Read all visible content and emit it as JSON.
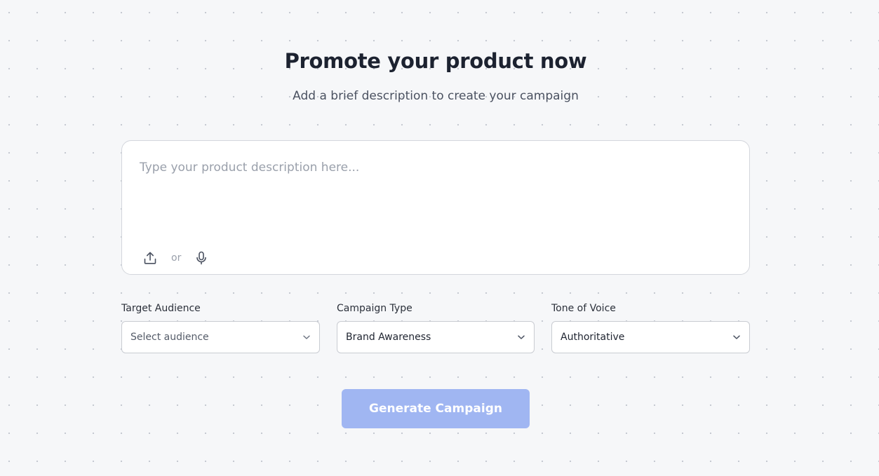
{
  "header": {
    "title": "Promote your product now",
    "subtitle": "Add a brief description to create your campaign"
  },
  "description": {
    "placeholder": "Type your product description here...",
    "value": "",
    "separator": "or",
    "upload_icon": "upload-icon",
    "mic_icon": "microphone-icon"
  },
  "fields": {
    "audience": {
      "label": "Target Audience",
      "value": "Select audience",
      "is_placeholder": true
    },
    "campaign_type": {
      "label": "Campaign Type",
      "value": "Brand Awareness"
    },
    "tone": {
      "label": "Tone of Voice",
      "value": "Authoritative"
    }
  },
  "actions": {
    "generate_label": "Generate Campaign"
  },
  "colors": {
    "primary_disabled": "#a0b6f2",
    "background": "#f6f7f9",
    "dot_pattern": "#c3c8d0",
    "heading": "#1c2230",
    "border": "#d3d6dc"
  }
}
